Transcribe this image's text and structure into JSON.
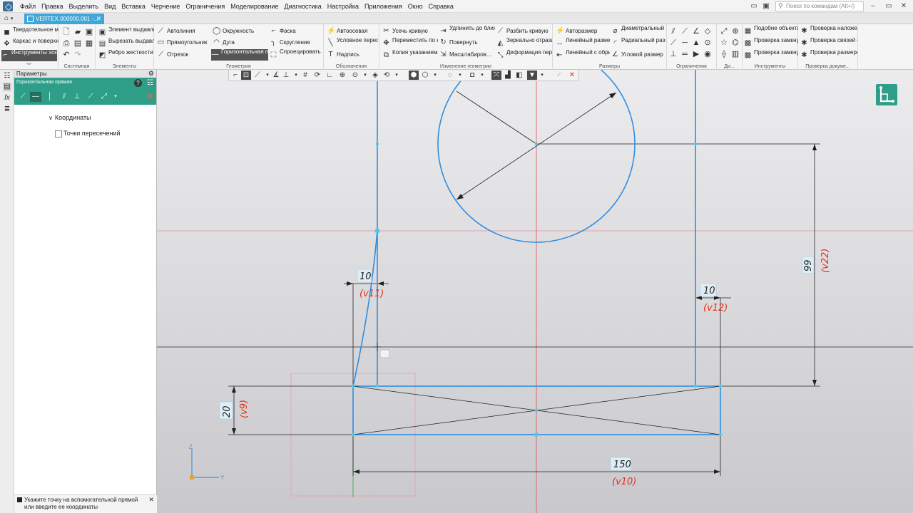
{
  "menu": [
    "Файл",
    "Правка",
    "Выделить",
    "Вид",
    "Вставка",
    "Черчение",
    "Ограничения",
    "Моделирование",
    "Диагностика",
    "Настройка",
    "Приложения",
    "Окно",
    "Справка"
  ],
  "command_search": {
    "placeholder": "Поиск по командам (Alt+/)"
  },
  "tabs": {
    "document": "VERTEX.000000.001 -..."
  },
  "ribbon": {
    "mode": {
      "items": [
        "Твердотельное моделирование",
        "Каркас и поверхности",
        "Инструменты эскиза"
      ]
    },
    "groups": {
      "system": "Системная",
      "elements": "Элементы",
      "geometry": "Геометрия",
      "annotations": "Обозначения",
      "edit_geometry": "Изменение геометрии",
      "dimensions": "Размеры",
      "constraints": "Ограничения",
      "di": "Ди...",
      "tools": "Инструменты",
      "doc_check": "Проверка докуме..."
    },
    "elements": [
      "Элемент выдавливания",
      "Вырезать выдавливанием",
      "Ребро жесткости"
    ],
    "geometry": [
      "Автолиния",
      "Прямоугольник",
      "Отрезок",
      "Окружность",
      "Дуга",
      "Горизонтальная прямая",
      "Фаска",
      "Скругление",
      "Спроецировать объект"
    ],
    "annotations": [
      "Автоосевая",
      "Условное пересечение",
      "Надпись"
    ],
    "edit_geometry": [
      "Усечь кривую",
      "Переместить по координатам",
      "Копия указанием",
      "Удлинить до ближайшего о...",
      "Повернуть",
      "Масштабиров...",
      "Разбить кривую",
      "Зеркально отразить",
      "Деформация перемещением"
    ],
    "dimensions": [
      "Авторазмер",
      "Линейный размер",
      "Линейный с обрывом",
      "Диаметральный размер",
      "Радиальный размер",
      "Угловой размер"
    ],
    "tools": [
      "Подобие объекта",
      "Проверка замкнутости д...",
      "Проверка замкнутости о..."
    ],
    "doc_check": [
      "Проверка наложения эл...",
      "Проверка связей обозна...",
      "Проверка размеров"
    ]
  },
  "panel": {
    "title": "Параметры",
    "command": "Горизонтальная прямая",
    "section": "Координаты",
    "checkbox": {
      "label": "Точки пересечений",
      "checked": false
    }
  },
  "status": {
    "hint": "Укажите точку на вспомогательной прямой или введите ее координаты"
  },
  "dimensions": [
    {
      "value": "10",
      "var": "(v11)"
    },
    {
      "value": "10",
      "var": "(v12)"
    },
    {
      "value": "99",
      "var": "(v22)"
    },
    {
      "value": "20",
      "var": "(v9)"
    },
    {
      "value": "150",
      "var": "(v10)"
    }
  ],
  "axis": {
    "z": "Z",
    "y": "Y"
  },
  "colors": {
    "accent": "#2f9e88",
    "geometry": "#2f8de0",
    "variable": "#e0301e",
    "construction": "#e87a8a"
  }
}
